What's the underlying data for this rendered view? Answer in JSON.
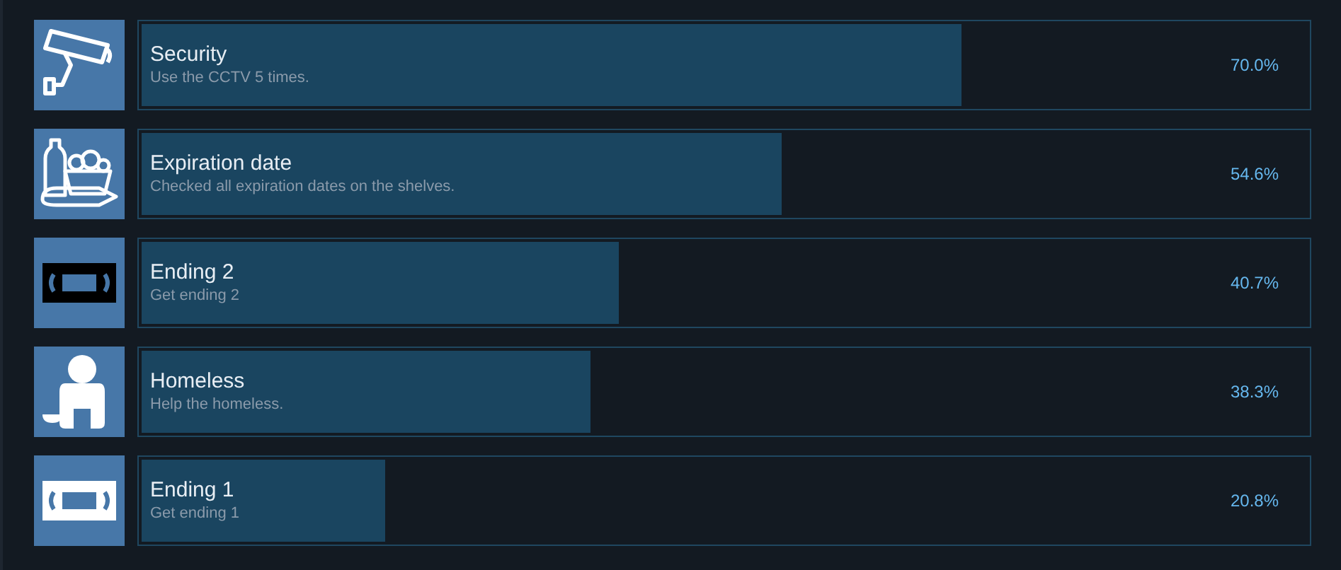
{
  "achievements": [
    {
      "kind": "cctv",
      "title": "Security",
      "description": "Use the CCTV 5 times.",
      "percent": "70.0%",
      "level": 0.7
    },
    {
      "kind": "groceries",
      "title": "Expiration date",
      "description": "Checked all expiration dates on the shelves.",
      "percent": "54.6%",
      "level": 0.546
    },
    {
      "kind": "tapedark",
      "title": "Ending 2",
      "description": "Get ending 2",
      "percent": "40.7%",
      "level": 0.407
    },
    {
      "kind": "figure",
      "title": "Homeless",
      "description": "Help the homeless.",
      "percent": "38.3%",
      "level": 0.383
    },
    {
      "kind": "tapelight",
      "title": "Ending 1",
      "description": "Get ending 1",
      "percent": "20.8%",
      "level": 0.208
    }
  ]
}
